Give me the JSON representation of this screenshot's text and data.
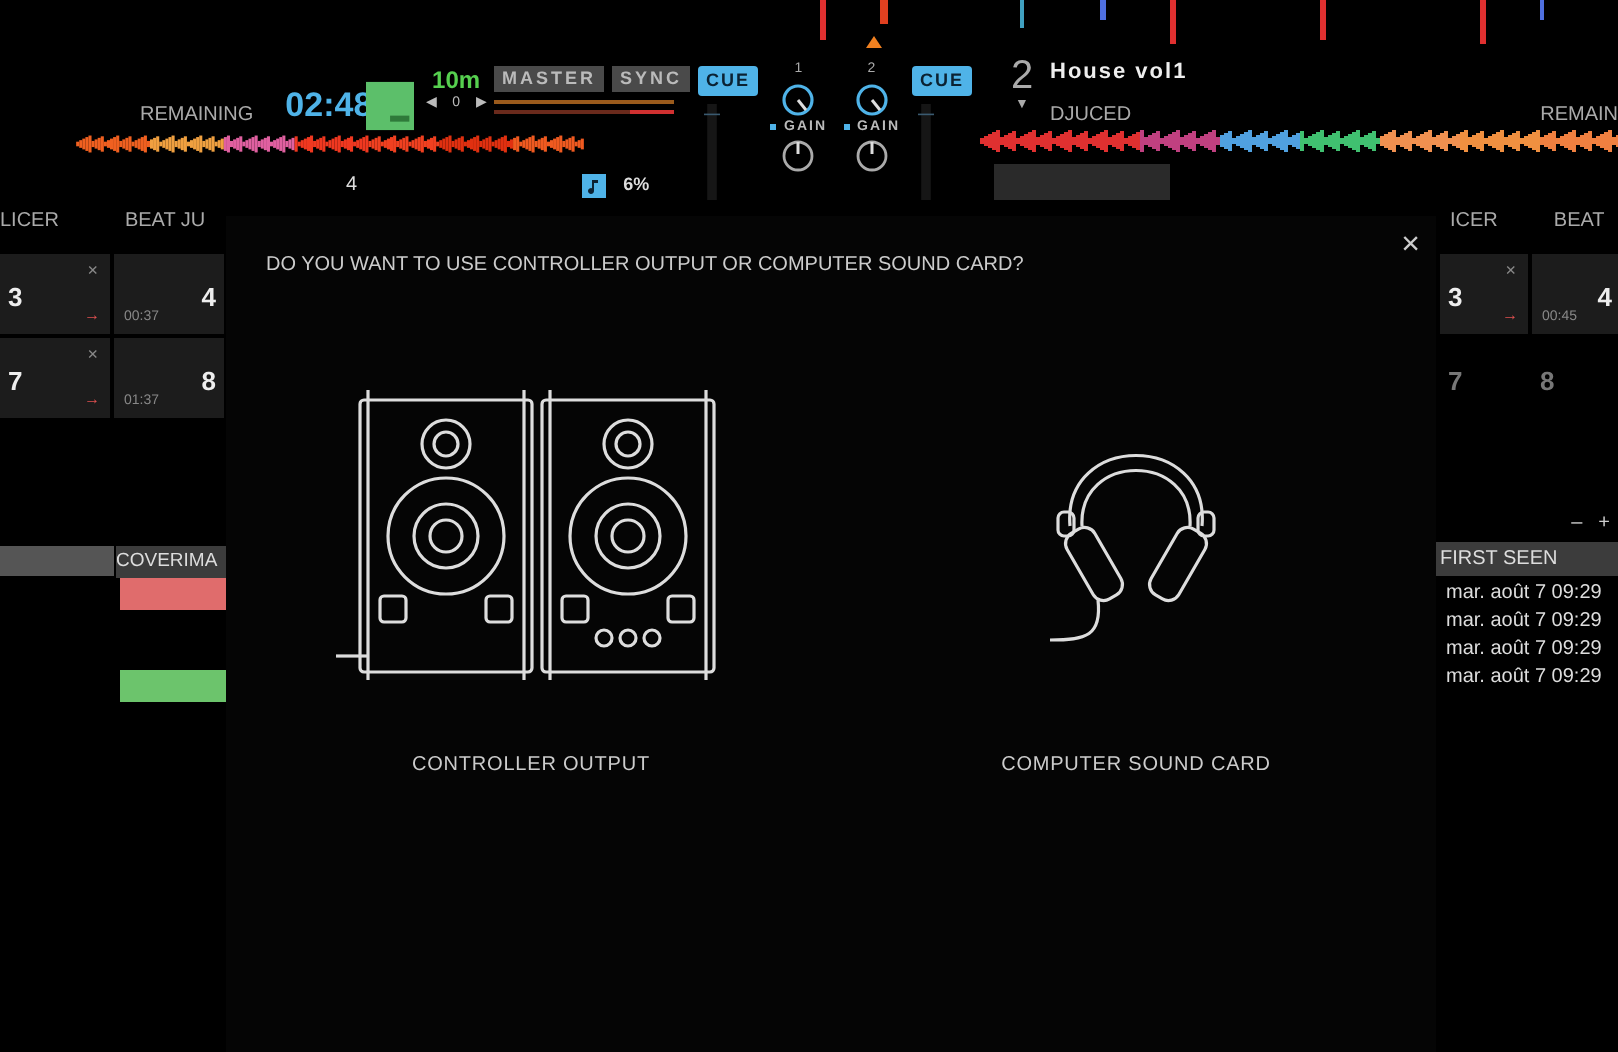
{
  "deck_1": {
    "time_label": "REMAINING",
    "time": "02:48",
    "key": "10m",
    "pitch": [
      "◀",
      "0",
      "▶"
    ],
    "buttons": [
      "MASTER",
      "SYNC"
    ],
    "beat": "4",
    "tempo": "6%",
    "tabs": [
      "LICER",
      "BEAT JU"
    ]
  },
  "mixer": {
    "cue_buttons": [
      "CUE",
      "CUE"
    ],
    "channels": [
      {
        "number": "1",
        "gain": "GAIN"
      },
      {
        "number": "2",
        "gain": "GAIN"
      }
    ]
  },
  "deck_2": {
    "number": "2",
    "arrow": "▼",
    "title": "House vol1",
    "artist": "DJUCED",
    "time_label": "REMAIN",
    "tabs": [
      "ICER",
      "BEAT"
    ]
  },
  "pads_left": [
    {
      "number": "3",
      "clear": "×",
      "arrow": "→"
    },
    {
      "number": "4",
      "time": "00:37"
    },
    {
      "number": "7",
      "clear": "×",
      "arrow": "→"
    },
    {
      "number": "8",
      "time": "01:37"
    }
  ],
  "pads_right": [
    {
      "number": "3",
      "clear": "×",
      "arrow": "→",
      "filled": true
    },
    {
      "number": "4",
      "time": "00:45",
      "filled": true
    },
    {
      "number": "7",
      "filled": false
    },
    {
      "number": "8",
      "filled": false
    }
  ],
  "library_left": {
    "columns": [
      "COVERIMA"
    ],
    "covers": [
      {
        "color": "#e06c6c"
      },
      {
        "color": "#6cc46c"
      }
    ]
  },
  "library_right": {
    "zoom": [
      "–",
      "+"
    ],
    "columns": [
      "FIRST SEEN"
    ],
    "rows": [
      "mar. août 7 09:29",
      "mar. août 7 09:29",
      "mar. août 7 09:29",
      "mar. août 7 09:29"
    ]
  },
  "dialog": {
    "question": "DO YOU WANT TO USE CONTROLLER OUTPUT OR COMPUTER SOUND CARD?",
    "close": "×",
    "options": [
      {
        "kind": "speakers",
        "label": "CONTROLLER OUTPUT"
      },
      {
        "kind": "headphones",
        "label": "COMPUTER SOUND CARD"
      }
    ]
  }
}
